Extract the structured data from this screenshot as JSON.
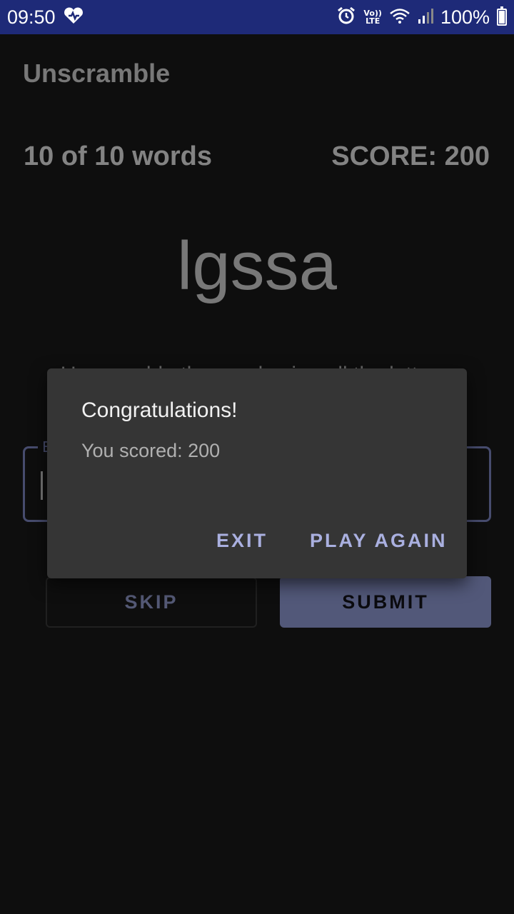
{
  "status_bar": {
    "time": "09:50",
    "volte_top": "Vo))",
    "volte_bottom": "LTE",
    "battery": "100%",
    "icons": [
      "health-heart-icon",
      "alarm-icon",
      "wifi-icon",
      "signal-icon",
      "battery-icon"
    ],
    "battery_level": 1.0
  },
  "app": {
    "title": "Unscramble",
    "word_count": "10 of 10 words",
    "score": "SCORE: 200",
    "scrambled_word": "lgssa",
    "instructions": "Unscramble the word using all the letters.",
    "input_label": "E",
    "skip_label": "SKIP",
    "submit_label": "SUBMIT"
  },
  "dialog": {
    "title": "Congratulations!",
    "message": "You scored: 200",
    "exit_label": "EXIT",
    "play_again_label": "PLAY AGAIN"
  },
  "colors": {
    "status_bar": "#1e2a78",
    "background": "#121212",
    "dialog": "#353535",
    "accent": "#aab0e0",
    "submit_button": "#6a719c"
  }
}
